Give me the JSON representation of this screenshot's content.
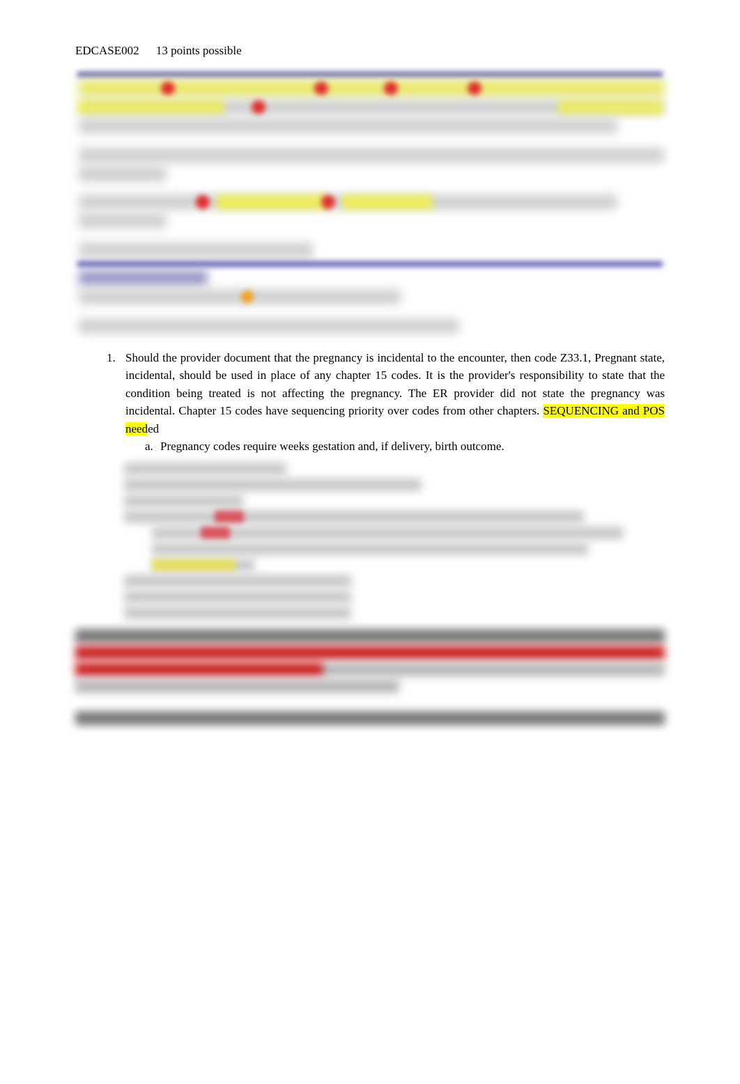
{
  "header": {
    "case_id": "EDCASE002",
    "points": "13 points possible"
  },
  "list": {
    "item1": {
      "text_a": "Should the provider document that the pregnancy is incidental to the encounter, then code Z33.1, Pregnant state, incidental, should be used in place of any chapter 15 codes. It is the provider's responsibility to state that the condition being treated is not affecting the pregnancy. The ER provider did not state the pregnan",
      "text_b": "cy was incidental.   Chapter 15 c",
      "text_c": "odes have sequencing priority over codes from other chapters.    ",
      "highlight": "SEQUENCING and POS need",
      "text_d": "ed",
      "sub_a": "Pregnancy codes require weeks gestation and, if delivery, birth outcome."
    }
  }
}
